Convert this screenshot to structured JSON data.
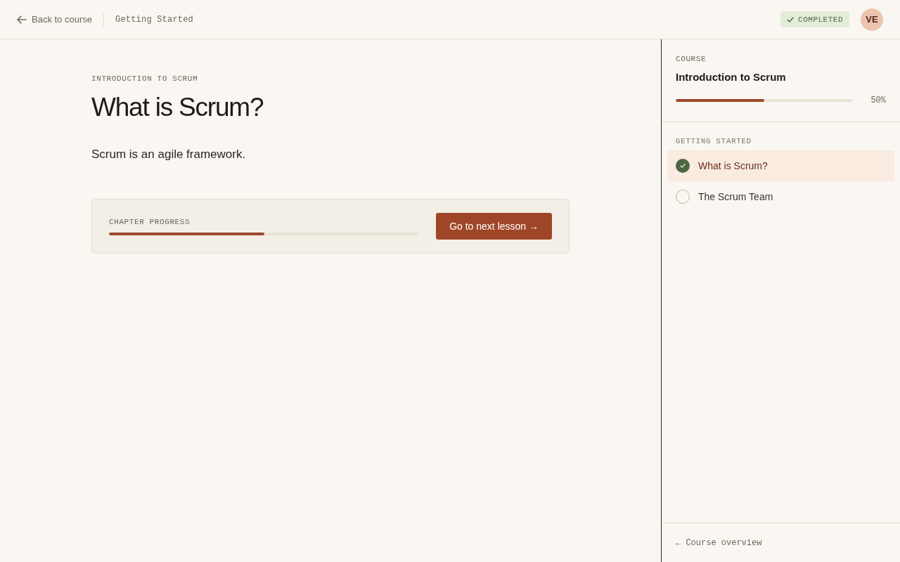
{
  "header": {
    "back_link": "Back to course",
    "breadcrumb": "Getting Started",
    "status_badge": {
      "label": "COMPLETED",
      "completed": true
    },
    "avatar": {
      "initials": "VE"
    }
  },
  "lesson": {
    "course_label": "INTRODUCTION TO SCRUM",
    "title": "What is Scrum?",
    "body": "Scrum is an agile framework.",
    "progress_card": {
      "label": "CHAPTER PROGRESS",
      "level": 0.5,
      "button": "Go to next lesson →"
    }
  },
  "sidebar": {
    "section_label": "COURSE",
    "course_title": "Introduction to Scrum",
    "progress": {
      "level": 0.5,
      "reading": "50%"
    },
    "chapters": [
      {
        "title": "GETTING STARTED",
        "lessons": [
          {
            "title": "What is Scrum?",
            "completed": true,
            "selected": true
          },
          {
            "title": "The Scrum Team",
            "completed": false,
            "selected": false
          }
        ]
      }
    ],
    "footer_link": "← Course overview"
  }
}
